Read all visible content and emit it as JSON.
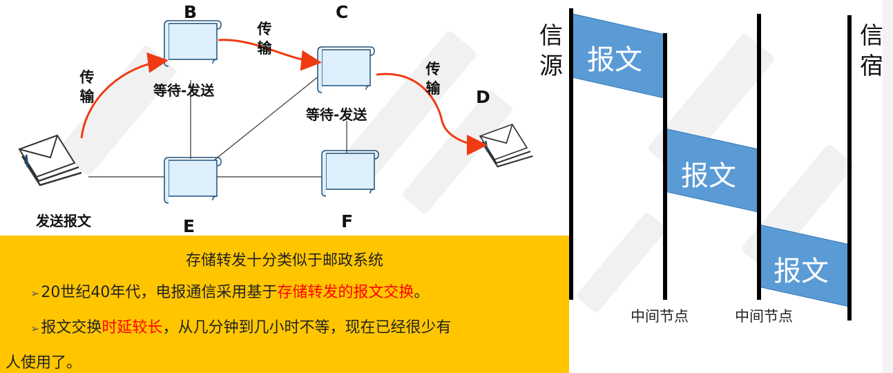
{
  "nodes": {
    "B": "B",
    "C": "C",
    "D": "D",
    "E": "E",
    "F": "F"
  },
  "labels": {
    "transmit_chars": [
      "传",
      "输"
    ],
    "wait_send": "等待-发送",
    "send_message": "发送报文"
  },
  "info_panel": {
    "title": "存储转发十分类似于邮政系统",
    "bullet_glyph": "➢",
    "line1_before": "20世纪40年代，电报通信采用基于",
    "line1_highlight": "存储转发的报文交换",
    "line1_after": "。",
    "line2_before": "报文交换",
    "line2_highlight": "时延较长",
    "line2_after": "，从几分钟到几小时不等，现在已经很少有",
    "line3": "人使用了。",
    "background": "#ffc600",
    "highlight_color": "#ff0000"
  },
  "timing_diagram": {
    "source_chars": [
      "信",
      "源"
    ],
    "dest_chars": [
      "信",
      "宿"
    ],
    "message_label": "报文",
    "intermediate_label": "中间节点",
    "message_color": "#5b9bd5"
  },
  "colors": {
    "arrow": "#ee3b12",
    "node_fill": "#ddf0fb",
    "node_border": "#1f4e79"
  }
}
